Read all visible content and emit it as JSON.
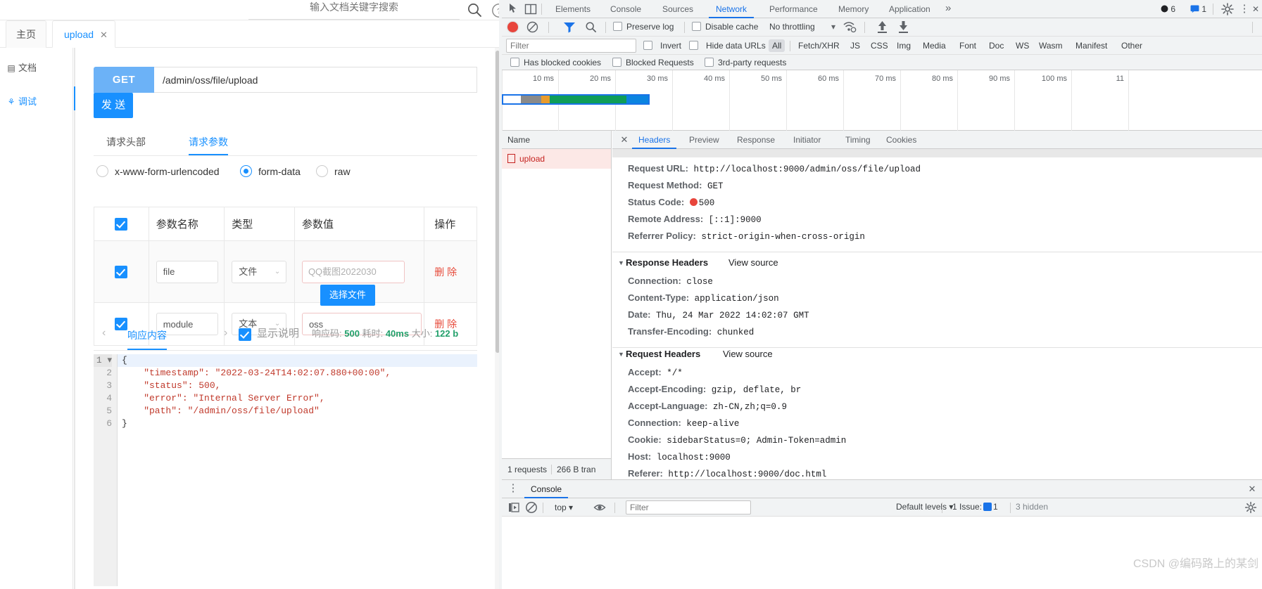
{
  "app": {
    "search": {
      "placeholder": "输入文档关键字搜索",
      "value": ""
    },
    "icons": {
      "search": "search-icon",
      "help": "help-circle-icon"
    },
    "tabs": [
      {
        "label": "主页",
        "active": false,
        "closable": false
      },
      {
        "label": "upload",
        "active": true,
        "closable": true,
        "close_glyph": "✕"
      }
    ],
    "nav": [
      {
        "label": "文档",
        "icon": "document-icon",
        "glyph": "▤",
        "active": false
      },
      {
        "label": "调试",
        "icon": "bug-icon",
        "glyph": "⚘",
        "active": true
      }
    ],
    "request": {
      "method": "GET",
      "url": "/admin/oss/file/upload",
      "send_label": "发 送"
    },
    "subtabs": [
      {
        "label": "请求头部",
        "active": false
      },
      {
        "label": "请求参数",
        "active": true
      }
    ],
    "body_types": [
      {
        "label": "x-www-form-urlencoded",
        "selected": false
      },
      {
        "label": "form-data",
        "selected": true
      },
      {
        "label": "raw",
        "selected": false
      }
    ],
    "param_table": {
      "headers": [
        "",
        "参数名称",
        "类型",
        "参数值",
        "操作"
      ],
      "header_checkbox_checked": true,
      "rows": [
        {
          "checked": true,
          "name": "file",
          "type": "文件",
          "value": "QQ截图2022030",
          "value_kind": "file",
          "choose_label": "选择文件",
          "op": "删 除"
        },
        {
          "checked": true,
          "name": "module",
          "type": "文本",
          "value": "oss",
          "value_kind": "text",
          "op": "删 除"
        }
      ]
    },
    "response": {
      "prev_glyph": "‹",
      "next_glyph": "›",
      "tab_label": "响应内容",
      "show_desc_checked": true,
      "show_desc_label": "显示说明",
      "status_label": "响应码:",
      "status_value": "500",
      "time_label": "耗时:",
      "time_value": "40ms",
      "size_label": "大小:",
      "size_value": "122 b",
      "code_lines": [
        {
          "n": "1",
          "text": "{",
          "highlight": true,
          "foldable": true
        },
        {
          "n": "2",
          "text": "    \"timestamp\": \"2022-03-24T14:02:07.880+00:00\","
        },
        {
          "n": "3",
          "text": "    \"status\": 500,"
        },
        {
          "n": "4",
          "text": "    \"error\": \"Internal Server Error\","
        },
        {
          "n": "5",
          "text": "    \"path\": \"/admin/oss/file/upload\""
        },
        {
          "n": "6",
          "text": "}"
        }
      ]
    }
  },
  "devtools": {
    "panel_tabs": [
      {
        "label": "Elements",
        "active": false
      },
      {
        "label": "Console",
        "active": false
      },
      {
        "label": "Sources",
        "active": false
      },
      {
        "label": "Network",
        "active": true
      },
      {
        "label": "Performance",
        "active": false
      },
      {
        "label": "Memory",
        "active": false
      },
      {
        "label": "Application",
        "active": false
      }
    ],
    "more_tabs_glyph": "»",
    "error_count": "6",
    "warning_count": "1",
    "icons": {
      "inspect": "inspect-element-icon",
      "device": "device-toolbar-icon",
      "record": "record-button-icon",
      "clear": "clear-network-log-icon",
      "filter": "filter-funnel-icon",
      "search": "search-icon",
      "throttle_wifi": "network-conditions-icon",
      "import_har": "import-har-icon",
      "export_har": "export-har-icon",
      "settings": "gear-icon",
      "kebab": "more-options-icon",
      "close": "close-icon"
    },
    "toolbar": {
      "preserve_log": {
        "label": "Preserve log",
        "checked": false
      },
      "disable_cache": {
        "label": "Disable cache",
        "checked": false
      },
      "throttling": {
        "label": "No throttling",
        "caret": "▾"
      }
    },
    "filterbar": {
      "filter_placeholder": "Filter",
      "filter_value": "",
      "invert": {
        "label": "Invert",
        "checked": false
      },
      "hide_data_urls": {
        "label": "Hide data URLs",
        "checked": false
      },
      "resource_types": [
        {
          "label": "All",
          "active": true
        },
        {
          "label": "Fetch/XHR",
          "active": false
        },
        {
          "label": "JS",
          "active": false
        },
        {
          "label": "CSS",
          "active": false
        },
        {
          "label": "Img",
          "active": false
        },
        {
          "label": "Media",
          "active": false
        },
        {
          "label": "Font",
          "active": false
        },
        {
          "label": "Doc",
          "active": false
        },
        {
          "label": "WS",
          "active": false
        },
        {
          "label": "Wasm",
          "active": false
        },
        {
          "label": "Manifest",
          "active": false
        },
        {
          "label": "Other",
          "active": false
        }
      ],
      "has_blocked_cookies": {
        "label": "Has blocked cookies",
        "checked": false
      },
      "blocked_requests": {
        "label": "Blocked Requests",
        "checked": false
      },
      "third_party": {
        "label": "3rd-party requests",
        "checked": false
      }
    },
    "overview": {
      "ticks": [
        "10 ms",
        "20 ms",
        "30 ms",
        "40 ms",
        "50 ms",
        "60 ms",
        "70 ms",
        "80 ms",
        "90 ms",
        "100 ms",
        "11"
      ],
      "bar_segments": [
        {
          "name": "queueing",
          "color": "#ffffff",
          "pct": 12
        },
        {
          "name": "stalled",
          "color": "#8a8a8a",
          "pct": 14
        },
        {
          "name": "dns",
          "color": "#e89b2c",
          "pct": 6
        },
        {
          "name": "waiting-ttfb",
          "color": "#0f9d58",
          "pct": 53
        },
        {
          "name": "content-download",
          "color": "#0b84e0",
          "pct": 15
        }
      ]
    },
    "requests_table": {
      "column_header": "Name",
      "rows": [
        {
          "name": "upload",
          "status": "error"
        }
      ]
    },
    "status_bar": {
      "requests": "1 requests",
      "transferred": "266 B tran"
    },
    "detail": {
      "tabs": [
        {
          "label": "Headers",
          "active": true
        },
        {
          "label": "Preview",
          "active": false
        },
        {
          "label": "Response",
          "active": false
        },
        {
          "label": "Initiator",
          "active": false
        },
        {
          "label": "Timing",
          "active": false
        },
        {
          "label": "Cookies",
          "active": false
        }
      ],
      "close_glyph": "✕",
      "general": [
        {
          "key": "Request URL:",
          "value": "http://localhost:9000/admin/oss/file/upload"
        },
        {
          "key": "Request Method:",
          "value": "GET"
        },
        {
          "key": "Status Code:",
          "value": "500",
          "has_status_dot": true
        },
        {
          "key": "Remote Address:",
          "value": "[::1]:9000"
        },
        {
          "key": "Referrer Policy:",
          "value": "strict-origin-when-cross-origin"
        }
      ],
      "response_headers": {
        "title": "Response Headers",
        "view_source": "View source",
        "items": [
          {
            "key": "Connection:",
            "value": "close"
          },
          {
            "key": "Content-Type:",
            "value": "application/json"
          },
          {
            "key": "Date:",
            "value": "Thu, 24 Mar 2022 14:02:07 GMT"
          },
          {
            "key": "Transfer-Encoding:",
            "value": "chunked"
          }
        ]
      },
      "request_headers": {
        "title": "Request Headers",
        "view_source": "View source",
        "items": [
          {
            "key": "Accept:",
            "value": "*/*"
          },
          {
            "key": "Accept-Encoding:",
            "value": "gzip, deflate, br"
          },
          {
            "key": "Accept-Language:",
            "value": "zh-CN,zh;q=0.9"
          },
          {
            "key": "Connection:",
            "value": "keep-alive"
          },
          {
            "key": "Cookie:",
            "value": "sidebarStatus=0; Admin-Token=admin"
          },
          {
            "key": "Host:",
            "value": "localhost:9000"
          },
          {
            "key": "Referer:",
            "value": "http://localhost:9000/doc.html"
          }
        ]
      }
    },
    "drawer": {
      "tab_label": "Console",
      "kebab_glyph": "⋮",
      "close_glyph": "✕",
      "icons": {
        "execute": "execute-icon",
        "clear_console": "clear-console-icon",
        "eye": "eye-icon",
        "settings": "gear-icon"
      },
      "context": "top",
      "context_caret": "▾",
      "filter_placeholder": "Filter",
      "filter_value": "",
      "levels": "Default levels",
      "levels_caret": "▾",
      "issues_label": "1 Issue:",
      "issues_count": "1",
      "hidden_label": "3 hidden"
    }
  },
  "watermark": "CSDN @编码路上的某剑",
  "colors": {
    "accent_blue": "#1890ff",
    "devtools_blue": "#1a73e8",
    "error_red": "#c5221f",
    "success_green": "#22a06b",
    "annotation_red": "#e8453c"
  }
}
